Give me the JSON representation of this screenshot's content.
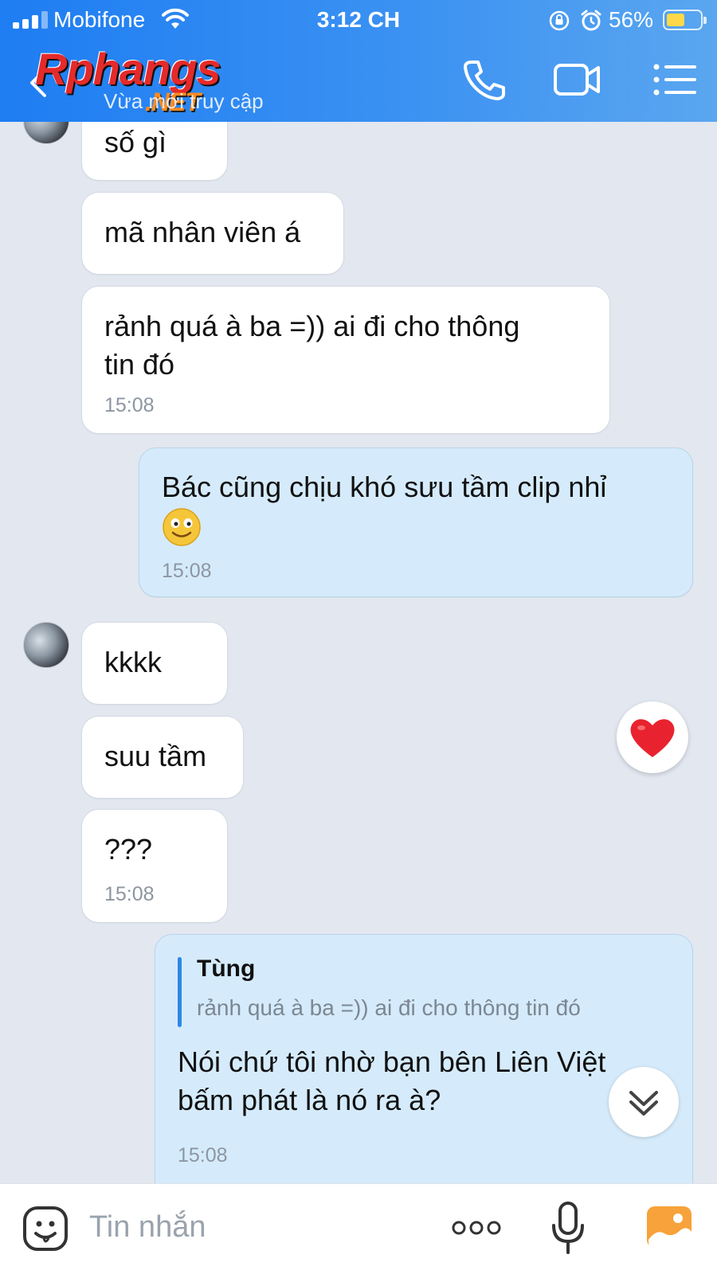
{
  "status_bar": {
    "carrier": "Mobifone",
    "time": "3:12 CH",
    "battery_percent": "56%",
    "battery_level": 0.56,
    "battery_color": "#ffd84a"
  },
  "header": {
    "logo_main": "Rphangs",
    "logo_suffix": ".NET",
    "subtitle": "Vừa mới truy cập",
    "icons": [
      "back-icon",
      "phone-icon",
      "video-icon",
      "menu-icon"
    ],
    "bg_color": "#2f86f0"
  },
  "messages": [
    {
      "side": "received",
      "text": "số gì"
    },
    {
      "side": "received",
      "text": "mã nhân viên á"
    },
    {
      "side": "received",
      "text_line1": "rảnh quá à ba =)) ai đi cho thông",
      "text_line2": "tin đó",
      "time": "15:08"
    },
    {
      "side": "sent",
      "text_line1": "Bác cũng chịu khó sưu tầm clip nhỉ",
      "emoji": "smiley-icon",
      "time": "15:08"
    },
    {
      "side": "received",
      "text": "kkkk"
    },
    {
      "side": "received",
      "text": "suu tầm"
    },
    {
      "side": "received",
      "text": "???",
      "time": "15:08"
    },
    {
      "side": "sent",
      "quote_name": "Tùng",
      "quote_text": "rảnh quá à ba =)) ai đi cho thông tin đó",
      "text_line1": "Nói chứ tôi nhờ bạn bên Liên Việt",
      "text_line2": "bấm phát là nó ra à?",
      "time": "15:08"
    }
  ],
  "reaction": {
    "icon": "heart-icon",
    "color": "#e8232f"
  },
  "scroll_down": {
    "icon": "double-chevron-down-icon"
  },
  "composer": {
    "placeholder": "Tin nhắn",
    "icons": [
      "sticker-icon",
      "more-icon",
      "microphone-icon",
      "photo-icon"
    ],
    "photo_color": "#f7a23a"
  }
}
